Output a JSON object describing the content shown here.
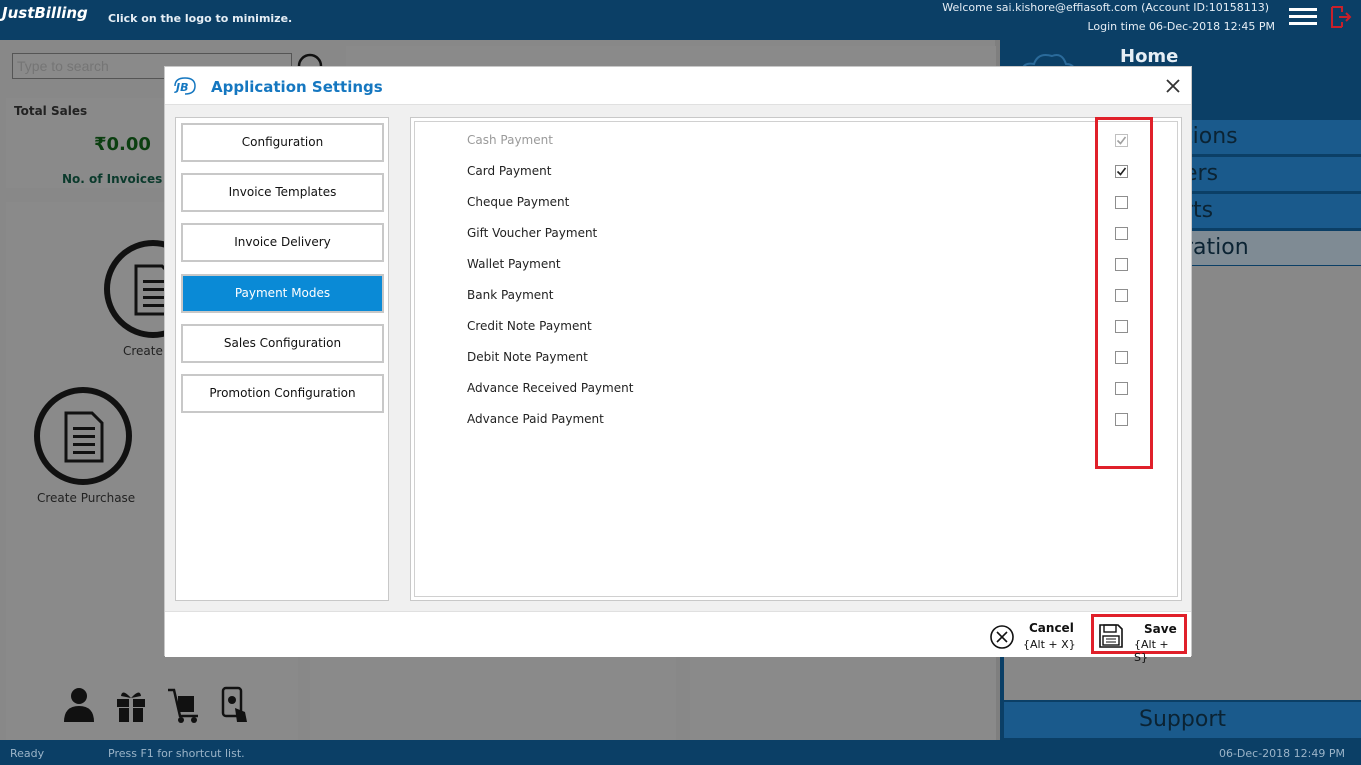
{
  "app": {
    "logo_text": "JustBilling",
    "logo_hint": "Click on the logo to minimize.",
    "welcome": "Welcome sai.kishore@effiasoft.com (Account ID:10158113)",
    "login_time": "Login time  06-Dec-2018 12:45 PM"
  },
  "search": {
    "placeholder": "Type to search"
  },
  "sales": {
    "total_label": "Total Sales",
    "amount": "₹0.00",
    "invoices_label": "No. of Invoices :"
  },
  "actions": {
    "create_label": "Create",
    "create_purchase_label": "Create Purchase"
  },
  "right_menu": {
    "home": "Home",
    "items": [
      "tions",
      "ers",
      "rts",
      "ration"
    ],
    "support": "Support"
  },
  "status": {
    "ready": "Ready",
    "hint": "Press F1 for shortcut list.",
    "time": "06-Dec-2018 12:49 PM"
  },
  "dialog": {
    "logo": "JB",
    "title": "Application Settings",
    "nav": [
      {
        "label": "Configuration",
        "active": false
      },
      {
        "label": "Invoice Templates",
        "active": false
      },
      {
        "label": "Invoice Delivery",
        "active": false
      },
      {
        "label": "Payment Modes",
        "active": true
      },
      {
        "label": "Sales Configuration",
        "active": false
      },
      {
        "label": "Promotion Configuration",
        "active": false
      }
    ],
    "payment_modes": [
      {
        "label": "Cash Payment",
        "checked": true,
        "disabled": true
      },
      {
        "label": "Card Payment",
        "checked": true,
        "disabled": false
      },
      {
        "label": "Cheque Payment",
        "checked": false,
        "disabled": false
      },
      {
        "label": "Gift Voucher Payment",
        "checked": false,
        "disabled": false
      },
      {
        "label": "Wallet Payment",
        "checked": false,
        "disabled": false
      },
      {
        "label": "Bank Payment",
        "checked": false,
        "disabled": false
      },
      {
        "label": "Credit Note Payment",
        "checked": false,
        "disabled": false
      },
      {
        "label": "Debit Note Payment",
        "checked": false,
        "disabled": false
      },
      {
        "label": "Advance Received Payment",
        "checked": false,
        "disabled": false
      },
      {
        "label": "Advance Paid Payment",
        "checked": false,
        "disabled": false
      }
    ],
    "cancel": {
      "label": "Cancel",
      "keys": "{Alt + X}"
    },
    "save": {
      "label": "Save",
      "keys": "{Alt + S}"
    }
  },
  "colors": {
    "accent": "#0a8ad6",
    "title_blue": "#1577c0",
    "highlight_red": "#e0202a",
    "app_navy": "#0b3f66"
  }
}
